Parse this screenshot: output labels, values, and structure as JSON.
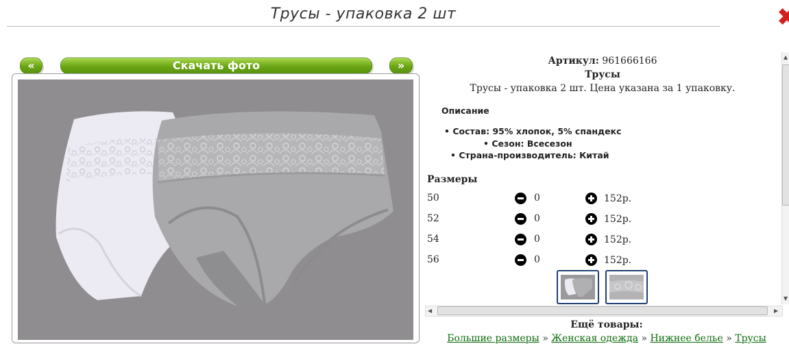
{
  "header": {
    "title": "Трусы - упаковка 2 шт"
  },
  "gallery": {
    "prev_label": "«",
    "download_label": "Скачать фото",
    "next_label": "»"
  },
  "product": {
    "article_label": "Артикул:",
    "article_value": "961666166",
    "name": "Трусы",
    "summary": "Трусы - упаковка 2 шт. Цена указана за 1 упаковку.",
    "description_heading": "Описание",
    "specs": [
      {
        "label": "Состав:",
        "value": "95% хлопок, 5% спандекс"
      },
      {
        "label": "Сезон:",
        "value": "Всесезон"
      },
      {
        "label": "Страна-производитель:",
        "value": "Китай"
      }
    ],
    "sizes_heading": "Размеры",
    "sizes": [
      {
        "size": "50",
        "qty": "0",
        "price": "152р."
      },
      {
        "size": "52",
        "qty": "0",
        "price": "152р."
      },
      {
        "size": "54",
        "qty": "0",
        "price": "152р."
      },
      {
        "size": "56",
        "qty": "0",
        "price": "152р."
      }
    ]
  },
  "more": {
    "label": "Ещё товары:",
    "breadcrumb": [
      "Большие размеры",
      "Женская одежда",
      "Нижнее белье",
      "Трусы"
    ],
    "separator": "»"
  },
  "colors": {
    "button_green": "#6aa514",
    "photo_bg": "#8f8d8f",
    "link_green": "#0b6d0b",
    "close_red": "#d42020"
  },
  "icons": [
    "close-icon",
    "minus-circle-icon",
    "plus-circle-icon"
  ]
}
